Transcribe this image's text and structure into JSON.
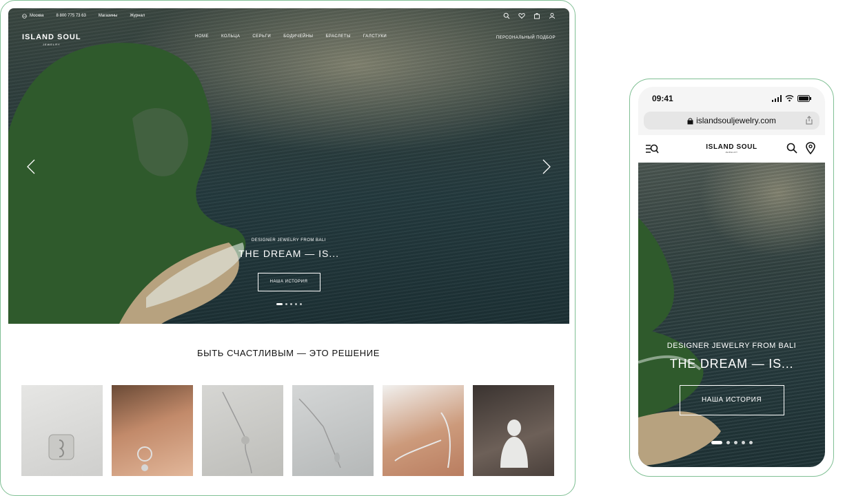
{
  "desktop": {
    "topbar": {
      "city": "Москва",
      "phone": "8 800 775 73 63",
      "stores": "Магазины",
      "journal": "Журнал",
      "icons": [
        "search-icon",
        "heart-icon",
        "bag-icon",
        "user-icon"
      ]
    },
    "logo": {
      "main": "ISLAND SOUL",
      "sub": "JEWELRY"
    },
    "nav": [
      "HOME",
      "КОЛЬЦА",
      "СЕРЬГИ",
      "БОДИЧЕЙНЫ",
      "БРАСЛЕТЫ",
      "ГАЛСТУКИ"
    ],
    "selection": "ПЕРСОНАЛЬНЫЙ ПОДБОР",
    "hero": {
      "subtitle": "DESIGNER JEWELRY FROM BALI",
      "title": "THE DREAM — IS...",
      "button": "НАША ИСТОРИЯ",
      "slides": 5,
      "active_slide": 1
    },
    "heading": "БЫТЬ СЧАСТЛИВЫМ — ЭТО РЕШЕНИЕ",
    "products": [
      "ring",
      "earring",
      "necklace-lotus",
      "necklace-drop",
      "bracelet",
      "buddha"
    ]
  },
  "mobile": {
    "time": "09:41",
    "url": "islandsouljewelry.com",
    "logo": {
      "main": "ISLAND SOUL",
      "sub": "JEWELRY"
    },
    "hero": {
      "subtitle": "DESIGNER JEWELRY FROM BALI",
      "title": "THE DREAM — IS...",
      "button": "НАША ИСТОРИЯ",
      "slides": 5,
      "active_slide": 1
    }
  },
  "colors": {
    "frame": "#7fbf93",
    "sea_dark": "#1c3034",
    "foliage": "#2f5a2c",
    "sand": "#b7a27f"
  }
}
